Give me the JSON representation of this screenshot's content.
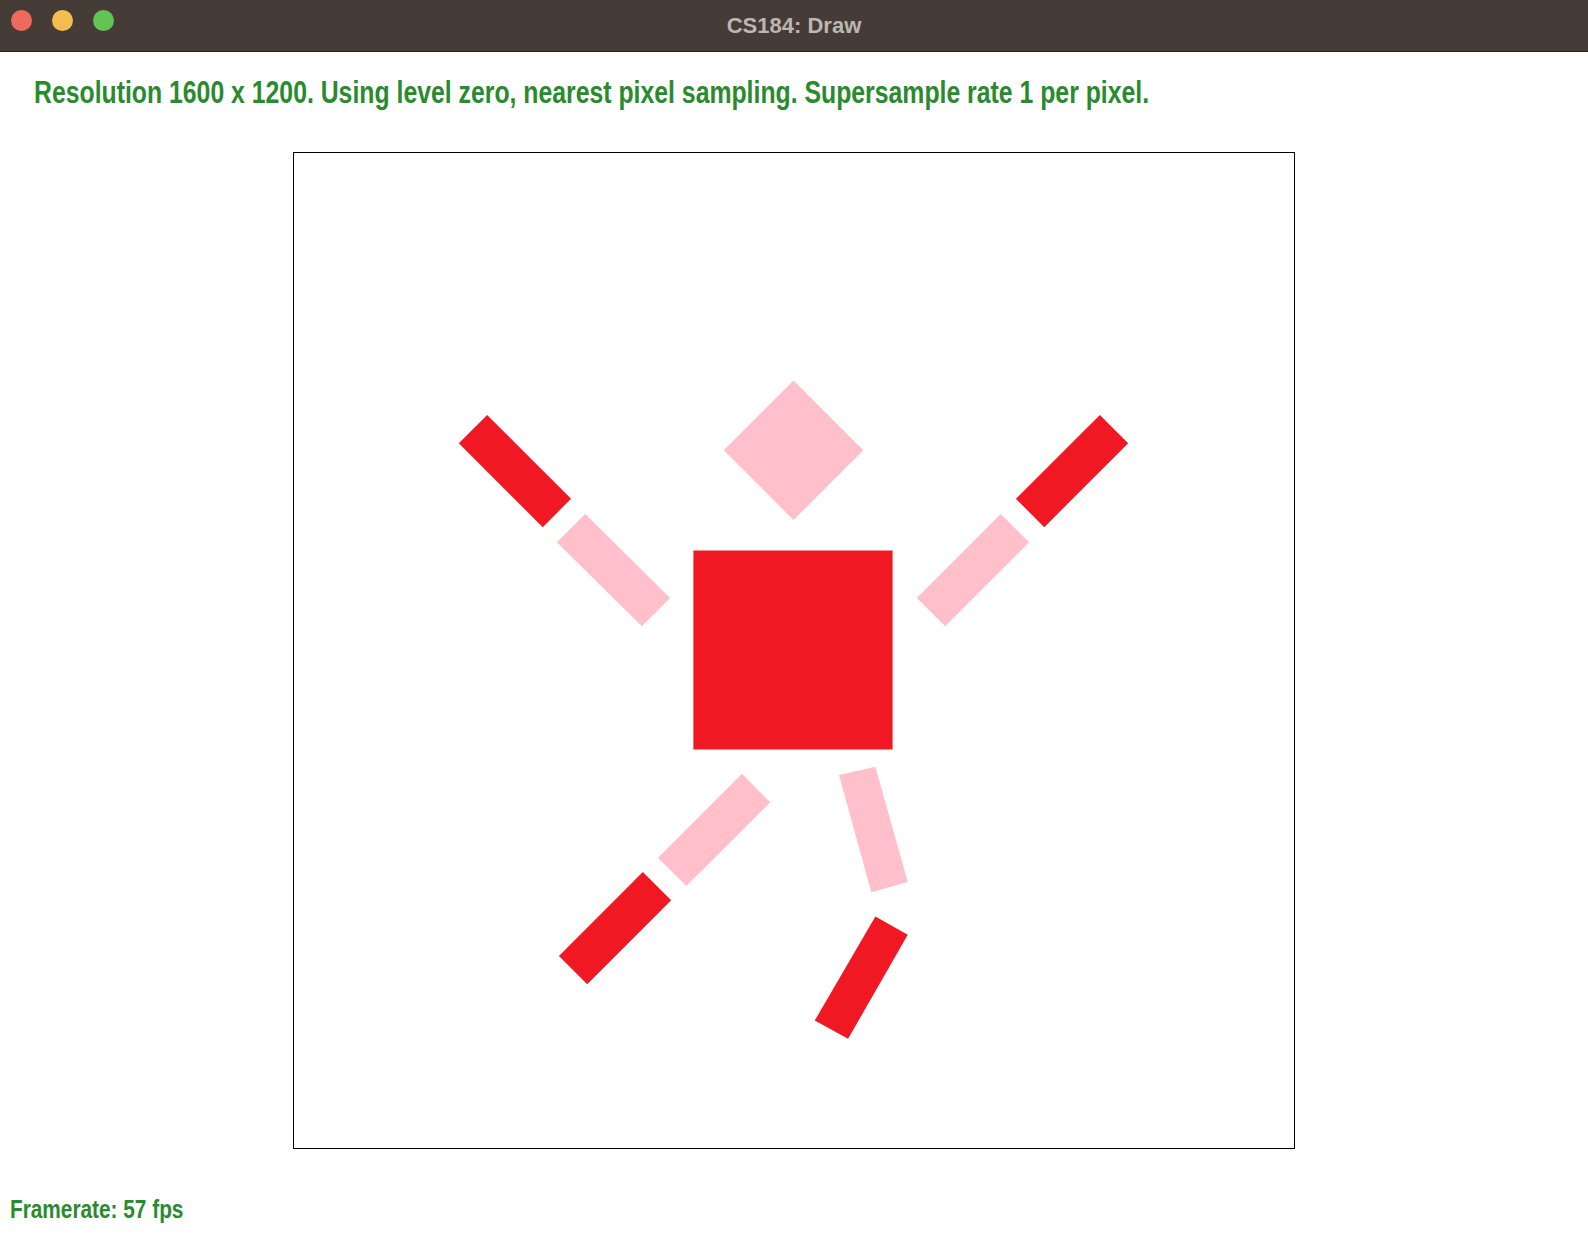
{
  "window": {
    "title": "CS184: Draw",
    "buttons": [
      {
        "name": "close",
        "color": "#ee6a5f"
      },
      {
        "name": "minimize",
        "color": "#f5bd4f"
      },
      {
        "name": "zoom",
        "color": "#61c454"
      }
    ]
  },
  "status": "Resolution 1600 x 1200. Using level zero, nearest pixel sampling. Supersample rate 1 per pixel.",
  "canvas": {
    "shapes": [
      {
        "name": "head",
        "color": "#ffc0cb"
      },
      {
        "name": "torso",
        "color": "#ef1823"
      },
      {
        "name": "left-upper-arm",
        "color": "#ef1823"
      },
      {
        "name": "left-forearm",
        "color": "#ffc0cb"
      },
      {
        "name": "right-upper-arm",
        "color": "#ef1823"
      },
      {
        "name": "right-forearm",
        "color": "#ffc0cb"
      },
      {
        "name": "left-thigh",
        "color": "#ffc0cb"
      },
      {
        "name": "left-shin",
        "color": "#ef1823"
      },
      {
        "name": "right-thigh",
        "color": "#ffc0cb"
      },
      {
        "name": "right-shin",
        "color": "#ef1823"
      }
    ]
  },
  "framerate": "Framerate: 57 fps"
}
